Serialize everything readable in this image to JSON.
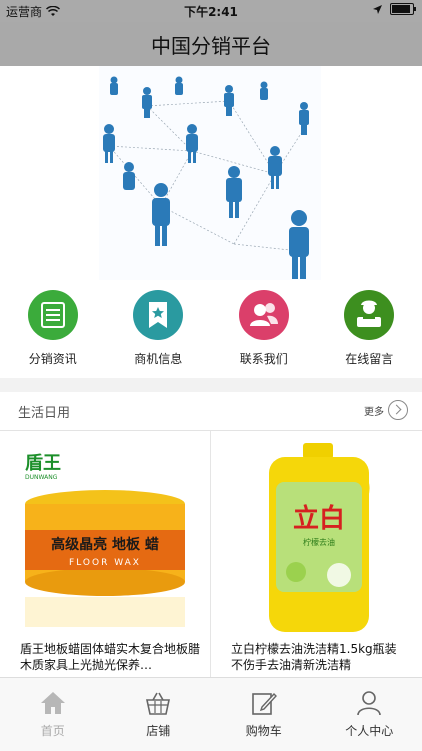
{
  "status_bar": {
    "carrier": "运营商",
    "time": "下午2:41"
  },
  "navbar": {
    "title": "中国分销平台"
  },
  "banner": {
    "slide_count": 4,
    "active_slide": 2
  },
  "quick_links": [
    {
      "label": "分销资讯",
      "icon": "document-icon",
      "color": "#3bab3b"
    },
    {
      "label": "商机信息",
      "icon": "bookmark-star-icon",
      "color": "#2a9aa0"
    },
    {
      "label": "联系我们",
      "icon": "contacts-icon",
      "color": "#db3f6a"
    },
    {
      "label": "在线留言",
      "icon": "message-icon",
      "color": "#3d8f1f"
    }
  ],
  "section": {
    "title": "生活日用",
    "more": "更多"
  },
  "products": [
    {
      "name": "盾王地板蜡固体蜡实木复合地板腊木质家具上光抛光保养…",
      "brand": "盾王",
      "brand_en": "DUNWANG",
      "label_cn": "高级晶亮 地板 蜡",
      "label_en": "FLOOR WAX"
    },
    {
      "name": "立白柠檬去油洗洁精1.5kg瓶装 不伤手去油清新洗洁精",
      "brand": "立白",
      "sub": "柠檬去油"
    }
  ],
  "tabbar": [
    {
      "label": "首页",
      "icon": "home-icon",
      "active": true
    },
    {
      "label": "店铺",
      "icon": "basket-icon",
      "active": false
    },
    {
      "label": "购物车",
      "icon": "edit-icon",
      "active": false
    },
    {
      "label": "个人中心",
      "icon": "person-icon",
      "active": false
    }
  ]
}
